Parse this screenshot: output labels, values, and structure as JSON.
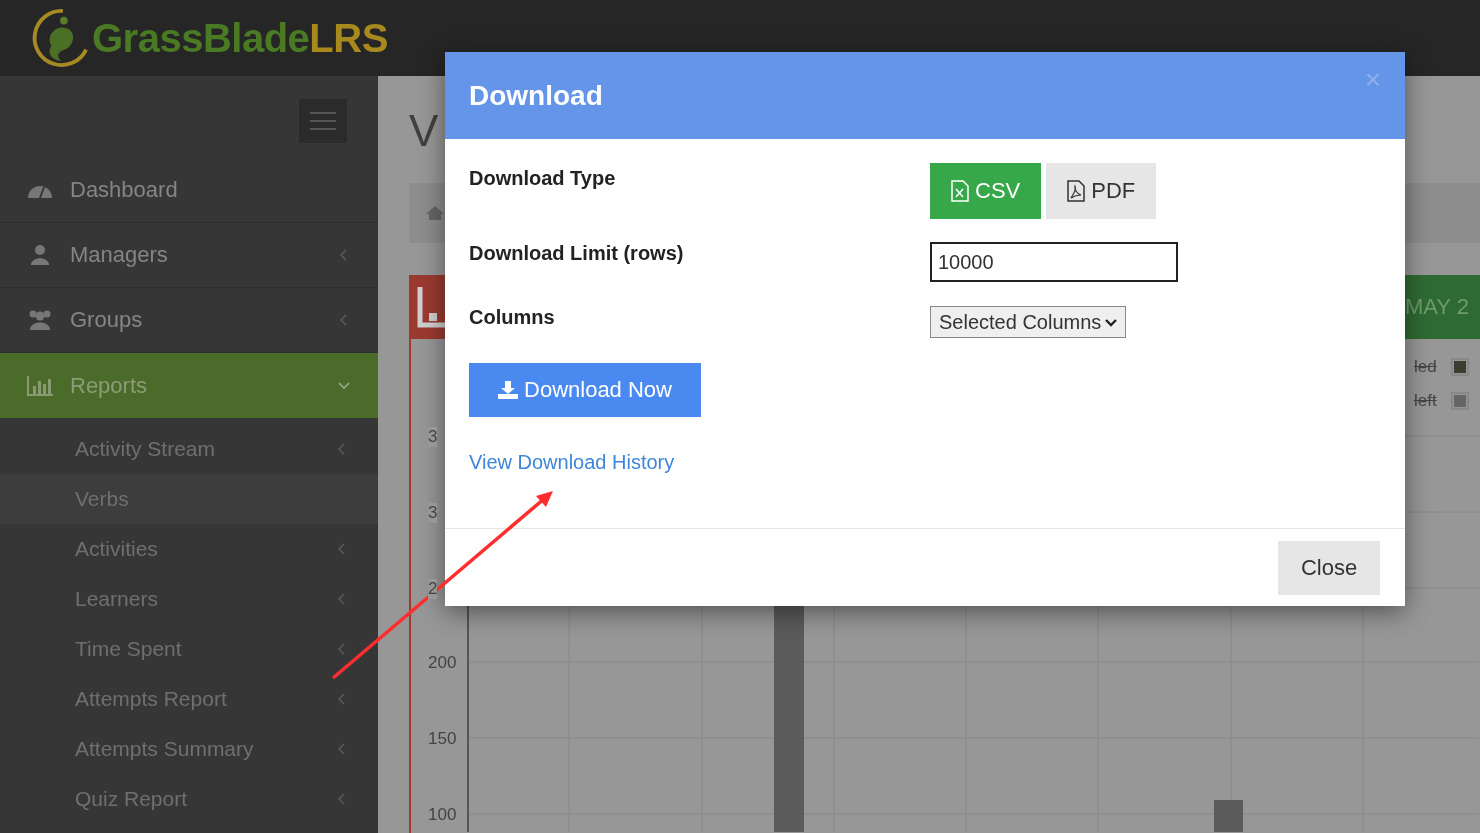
{
  "header": {
    "logo_text": "GrassBlade",
    "logo_accent": "LRS"
  },
  "sidebar": {
    "items": [
      {
        "label": "Dashboard",
        "kind": "link",
        "selected": false
      },
      {
        "label": "Managers",
        "kind": "menu",
        "expanded": false,
        "selected": false
      },
      {
        "label": "Groups",
        "kind": "menu",
        "expanded": false,
        "selected": false
      },
      {
        "label": "Reports",
        "kind": "menu",
        "expanded": true,
        "selected": true,
        "children": [
          {
            "label": "Activity Stream",
            "kind": "menu",
            "selected": false
          },
          {
            "label": "Verbs",
            "kind": "link",
            "selected": true
          },
          {
            "label": "Activities",
            "kind": "menu",
            "selected": false
          },
          {
            "label": "Learners",
            "kind": "menu",
            "selected": false
          },
          {
            "label": "Time Spent",
            "kind": "menu",
            "selected": false
          },
          {
            "label": "Attempts Report",
            "kind": "menu",
            "selected": false
          },
          {
            "label": "Attempts Summary",
            "kind": "menu",
            "selected": false
          },
          {
            "label": "Quiz Report",
            "kind": "menu",
            "selected": false
          }
        ]
      }
    ]
  },
  "page": {
    "title": "V",
    "date_badge": "MAY 2",
    "legend": [
      {
        "label": "led",
        "color": "#3d3d2f",
        "hidden": true
      },
      {
        "label": "left",
        "color": "#656565",
        "hidden": true
      }
    ],
    "y_labels": [
      "3",
      "3",
      "2",
      "200",
      "150",
      "100"
    ]
  },
  "modal": {
    "title": "Download",
    "close": "×",
    "download_type": {
      "label": "Download Type",
      "options": [
        {
          "label": "CSV",
          "kind": "csv",
          "selected": true
        },
        {
          "label": "PDF",
          "kind": "pdf",
          "selected": false
        }
      ]
    },
    "limit": {
      "label": "Download Limit (rows)",
      "value": "10000"
    },
    "columns": {
      "label": "Columns",
      "value": "Selected Columns"
    },
    "download_button": "Download Now",
    "history_link": "View Download History",
    "close_button": "Close"
  }
}
